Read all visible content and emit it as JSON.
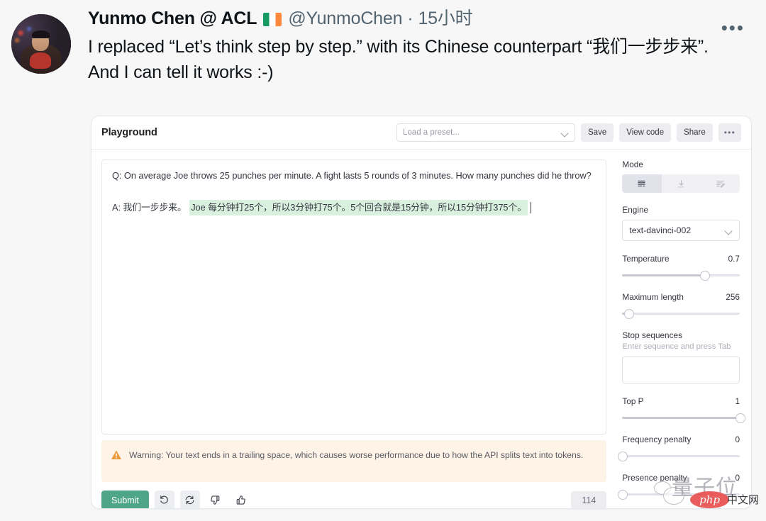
{
  "tweet": {
    "display_name": "Yunmo Chen @ ACL",
    "flag": "ie-flag-icon",
    "handle": "@YunmoChen",
    "separator": "·",
    "time": "15小时",
    "more_label": "•••",
    "text": "I replaced “Let’s think step by step.” with its Chinese counterpart “我们一步步来”. And I can tell it works :-)"
  },
  "playground": {
    "title": "Playground",
    "preset_placeholder": "Load a preset...",
    "buttons": {
      "save": "Save",
      "view_code": "View code",
      "share": "Share",
      "more": "•••"
    },
    "editor": {
      "prompt": "Q: On average Joe throws 25 punches per minute. A fight lasts 5 rounds of 3 minutes. How many punches did he throw?\nA: 我们一步步来。",
      "completion": "Joe 每分钟打25个，所以3分钟打75个。5个回合就是15分钟，所以15分钟打375个。"
    },
    "warning": {
      "icon": "warning-triangle-icon",
      "text": "Warning: Your text ends in a trailing space, which causes worse performance due to how the API splits text into tokens."
    },
    "footer": {
      "submit": "Submit",
      "undo_icon": "undo-icon",
      "regenerate_icon": "regenerate-icon",
      "thumbs_down_icon": "thumbs-down-icon",
      "thumbs_up_icon": "thumbs-up-icon",
      "token_count": "114"
    },
    "sidebar": {
      "mode_label": "Mode",
      "modes": [
        {
          "name": "complete-mode",
          "icon": "lines-icon",
          "active": true
        },
        {
          "name": "insert-mode",
          "icon": "download-arrow-icon",
          "active": false
        },
        {
          "name": "edit-mode",
          "icon": "lines-pencil-icon",
          "active": false
        }
      ],
      "engine_label": "Engine",
      "engine_value": "text-davinci-002",
      "temperature_label": "Temperature",
      "temperature_value": "0.7",
      "temperature_pct": 70,
      "max_length_label": "Maximum length",
      "max_length_value": "256",
      "max_length_pct": 5,
      "stop_label": "Stop sequences",
      "stop_hint": "Enter sequence and press Tab",
      "stop_value": "",
      "top_p_label": "Top P",
      "top_p_value": "1",
      "top_p_pct": 100,
      "frequency_label": "Frequency penalty",
      "frequency_value": "0",
      "frequency_pct": 0,
      "presence_label": "Presence penalty",
      "presence_value": "0",
      "presence_pct": 0
    }
  },
  "watermark": {
    "chars": "量子位",
    "badge": "php",
    "suffix": "中文网"
  },
  "colors": {
    "accent_green": "#4fa588",
    "highlight_green": "#d9f0df",
    "warning_bg": "#fdf3e7",
    "warning_icon": "#e8993a",
    "page_bg": "#f7f7f7"
  }
}
